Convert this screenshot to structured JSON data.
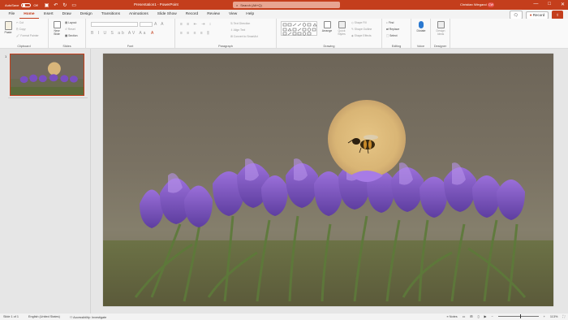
{
  "titlebar": {
    "autosave_label": "AutoSave",
    "autosave_state": "Off",
    "doc_title": "Presentation1 - PowerPoint",
    "search_placeholder": "Search (Alt+Q)",
    "user_name": "Christian Wiegand",
    "user_initials": "CW",
    "controls": [
      "—",
      "□",
      "✕"
    ],
    "qat_icons": [
      "save-icon",
      "undo-icon",
      "redo-icon",
      "present-icon"
    ]
  },
  "tabs": {
    "items": [
      "File",
      "Home",
      "Insert",
      "Draw",
      "Design",
      "Transitions",
      "Animations",
      "Slide Show",
      "Record",
      "Review",
      "View",
      "Help"
    ],
    "active": "Home",
    "record_button": "Record",
    "share_icon": "share-icon"
  },
  "ribbon": {
    "clipboard": {
      "label": "Clipboard",
      "paste": "Paste",
      "cut": "Cut",
      "copy": "Copy",
      "format_painter": "Format Painter"
    },
    "slides": {
      "label": "Slides",
      "new_slide": "New Slide",
      "layout": "Layout",
      "reset": "Reset",
      "section": "Section"
    },
    "font": {
      "label": "Font"
    },
    "paragraph": {
      "label": "Paragraph",
      "text_direction": "Text Direction",
      "align_text": "Align Text",
      "convert_smartart": "Convert to SmartArt"
    },
    "drawing": {
      "label": "Drawing",
      "arrange": "Arrange",
      "quick_styles": "Quick Styles",
      "shape_fill": "Shape Fill",
      "shape_outline": "Shape Outline",
      "shape_effects": "Shape Effects"
    },
    "editing": {
      "label": "Editing",
      "find": "Find",
      "replace": "Replace",
      "select": "Select"
    },
    "voice": {
      "label": "Voice",
      "dictate": "Dictate"
    },
    "designer": {
      "label": "Designer",
      "design_ideas": "Design Ideas"
    }
  },
  "slides_panel": {
    "slide_number": "1"
  },
  "statusbar": {
    "slide_info": "Slide 1 of 1",
    "language": "English (United States)",
    "accessibility": "Accessibility: Investigate",
    "notes": "Notes",
    "zoom": "113%"
  }
}
